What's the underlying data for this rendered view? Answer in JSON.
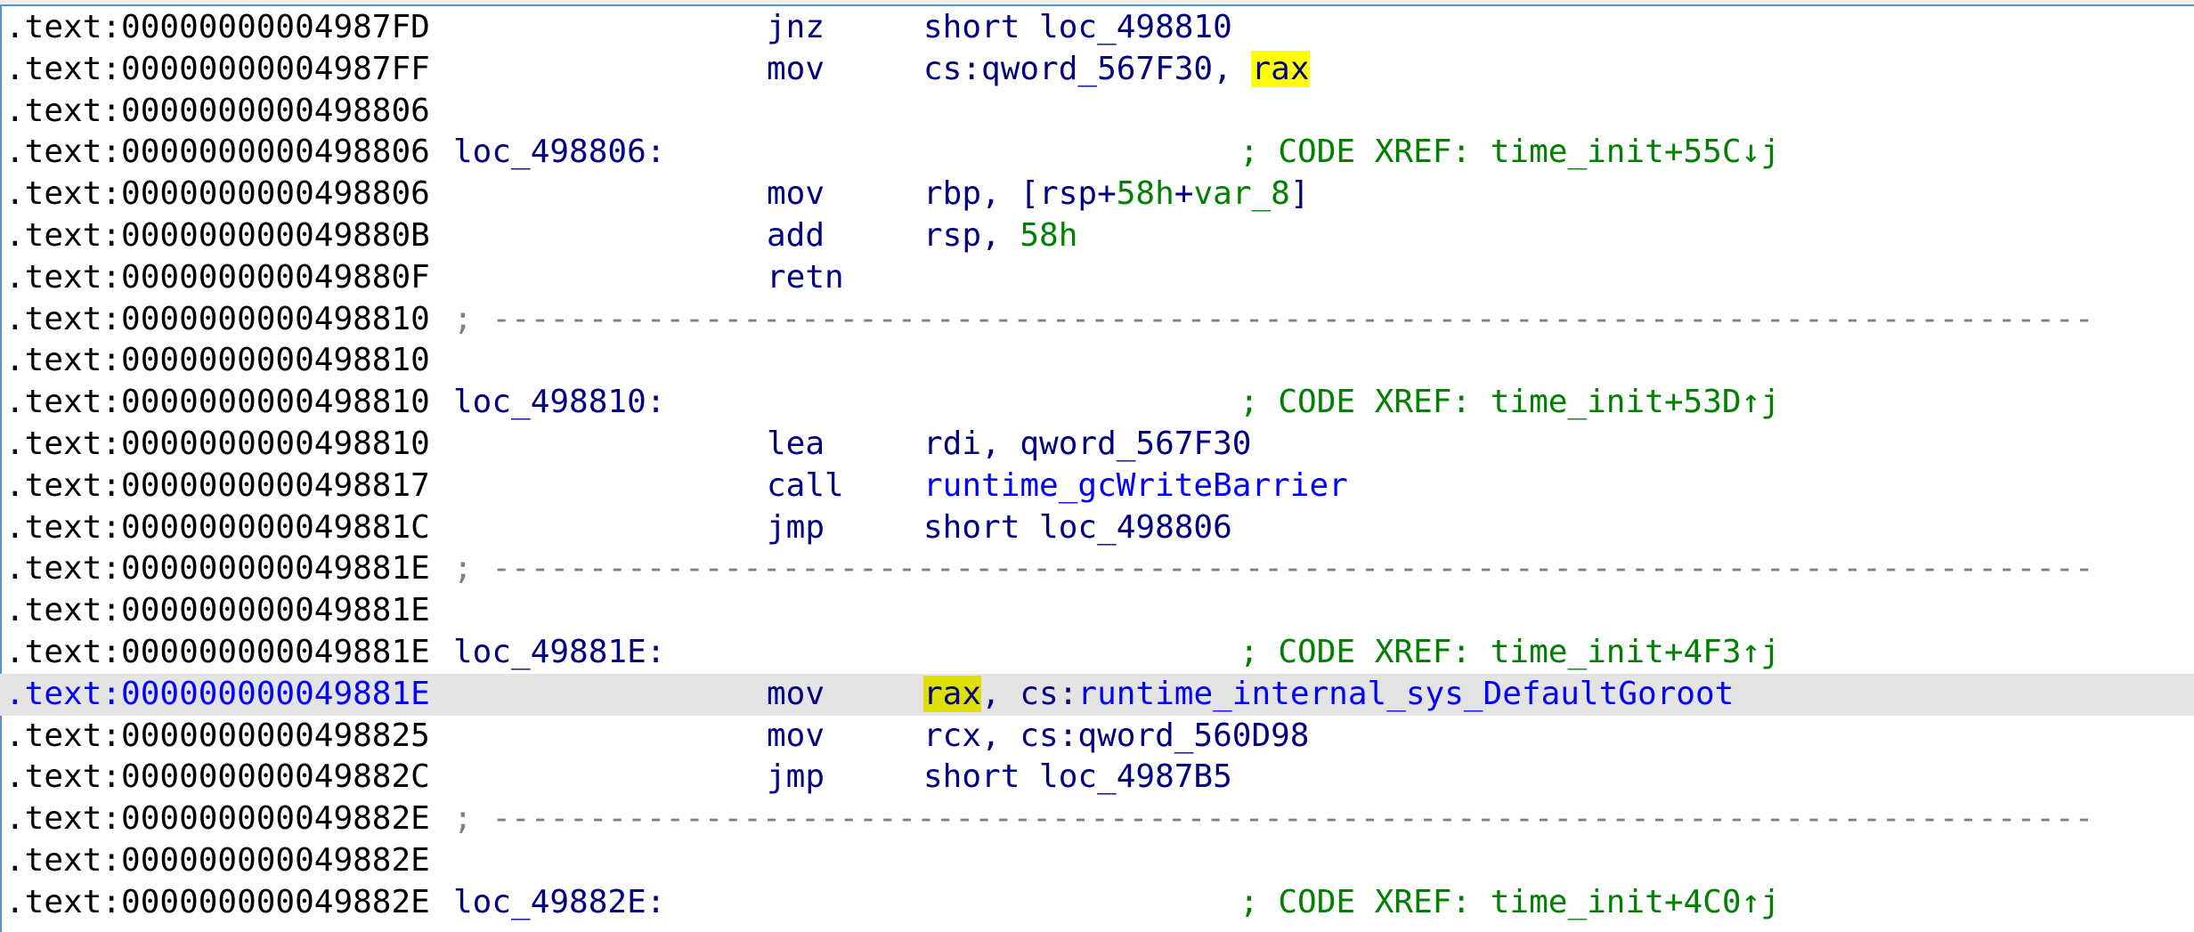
{
  "colors": {
    "address": "#000000",
    "label": "#000080",
    "mnemonic": "#000080",
    "number": "#008000",
    "function": "#0000ff",
    "comment": "#008000",
    "highlight": "#ffff00",
    "current_line_bg": "#e4e4e4"
  },
  "separator": "; -----------------------------------------------------------------------------------",
  "lines": [
    {
      "addr": ".text:00000000004987FD",
      "mnem": "jnz",
      "ops": [
        {
          "t": "short loc_498810",
          "c": "c-reg"
        }
      ]
    },
    {
      "addr": ".text:00000000004987FF",
      "mnem": "mov",
      "ops": [
        {
          "t": "cs:qword_567F30, ",
          "c": "c-reg"
        },
        {
          "t": "rax",
          "c": "c-reg hly"
        }
      ]
    },
    {
      "addr": ".text:0000000000498806"
    },
    {
      "addr": ".text:0000000000498806",
      "label": "loc_498806:",
      "comment": "; CODE XREF: time_init+55C↓j"
    },
    {
      "addr": ".text:0000000000498806",
      "mnem": "mov",
      "ops": [
        {
          "t": "rbp, [rsp+",
          "c": "c-reg"
        },
        {
          "t": "58h",
          "c": "c-num"
        },
        {
          "t": "+",
          "c": "c-reg"
        },
        {
          "t": "var_8",
          "c": "c-num"
        },
        {
          "t": "]",
          "c": "c-reg"
        }
      ]
    },
    {
      "addr": ".text:000000000049880B",
      "mnem": "add",
      "ops": [
        {
          "t": "rsp, ",
          "c": "c-reg"
        },
        {
          "t": "58h",
          "c": "c-num"
        }
      ]
    },
    {
      "addr": ".text:000000000049880F",
      "mnem": "retn"
    },
    {
      "addr": ".text:0000000000498810",
      "sep": true
    },
    {
      "addr": ".text:0000000000498810"
    },
    {
      "addr": ".text:0000000000498810",
      "label": "loc_498810:",
      "comment": "; CODE XREF: time_init+53D↑j"
    },
    {
      "addr": ".text:0000000000498810",
      "mnem": "lea",
      "ops": [
        {
          "t": "rdi, qword_567F30",
          "c": "c-reg"
        }
      ]
    },
    {
      "addr": ".text:0000000000498817",
      "mnem": "call",
      "ops": [
        {
          "t": "runtime_gcWriteBarrier",
          "c": "c-fn"
        }
      ]
    },
    {
      "addr": ".text:000000000049881C",
      "mnem": "jmp",
      "ops": [
        {
          "t": "short loc_498806",
          "c": "c-reg"
        }
      ]
    },
    {
      "addr": ".text:000000000049881E",
      "sep": true
    },
    {
      "addr": ".text:000000000049881E"
    },
    {
      "addr": ".text:000000000049881E",
      "label": "loc_49881E:",
      "comment": "; CODE XREF: time_init+4F3↑j"
    },
    {
      "addr": ".text:000000000049881E",
      "mnem": "mov",
      "current": true,
      "ops": [
        {
          "t": "rax",
          "c": "c-reg hly2"
        },
        {
          "t": ", cs:",
          "c": "c-reg"
        },
        {
          "t": "runtime_internal_sys_DefaultGoroot",
          "c": "c-fn"
        }
      ]
    },
    {
      "addr": ".text:0000000000498825",
      "mnem": "mov",
      "ops": [
        {
          "t": "rcx, cs:qword_560D98",
          "c": "c-reg"
        }
      ]
    },
    {
      "addr": ".text:000000000049882C",
      "mnem": "jmp",
      "ops": [
        {
          "t": "short loc_4987B5",
          "c": "c-reg"
        }
      ]
    },
    {
      "addr": ".text:000000000049882E",
      "sep": true
    },
    {
      "addr": ".text:000000000049882E"
    },
    {
      "addr": ".text:000000000049882E",
      "label": "loc_49882E:",
      "comment": "; CODE XREF: time_init+4C0↑j"
    }
  ]
}
